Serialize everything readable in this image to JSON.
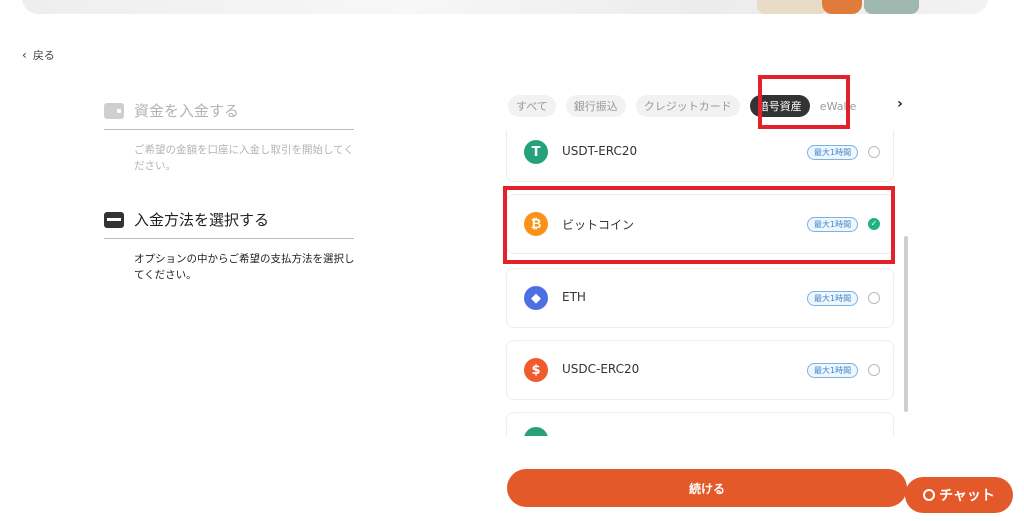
{
  "nav": {
    "back_label": "戻る"
  },
  "steps": [
    {
      "title": "資金を入金する",
      "desc": "ご希望の金額を口座に入金し取引を開始してください。"
    },
    {
      "title": "入金方法を選択する",
      "desc": "オプションの中からご希望の支払方法を選択してください。"
    }
  ],
  "tabs": [
    "すべて",
    "銀行振込",
    "クレジットカード",
    "暗号資産",
    "eWallet"
  ],
  "active_tab": "暗号資産",
  "payment_methods": [
    {
      "name": "USDT-ERC20",
      "badge": "最大1時間",
      "selected": false,
      "icon": "tether-icon",
      "color": "#26a17b",
      "glyph": "T"
    },
    {
      "name": "ビットコイン",
      "badge": "最大1時間",
      "selected": true,
      "icon": "bitcoin-icon",
      "color": "#f7931a",
      "glyph": "₿"
    },
    {
      "name": "ETH",
      "badge": "最大1時間",
      "selected": false,
      "icon": "ethereum-icon",
      "color": "#4d6fe1",
      "glyph": "◆"
    },
    {
      "name": "USDC-ERC20",
      "badge": "最大1時間",
      "selected": false,
      "icon": "usdc-icon",
      "color": "#ef5a2f",
      "glyph": "$"
    }
  ],
  "buttons": {
    "continue_label": "続ける",
    "chat_label": "チャット"
  },
  "colors": {
    "accent": "#e4592a",
    "highlight": "#e3212b",
    "selected": "#20b27a"
  }
}
